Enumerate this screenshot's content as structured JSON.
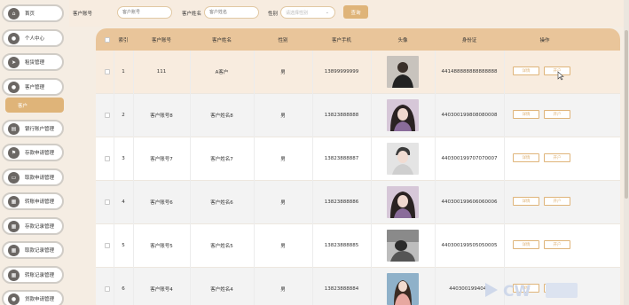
{
  "sidebar": {
    "items": [
      {
        "label": "首页",
        "icon": "home-icon"
      },
      {
        "label": "个人中心",
        "icon": "user-icon"
      },
      {
        "label": "租赁管理",
        "icon": "send-icon"
      },
      {
        "label": "客户管理",
        "icon": "person-icon"
      },
      {
        "label": "银行账户管理",
        "icon": "bank-icon"
      },
      {
        "label": "存款申请管理",
        "icon": "flag-icon"
      },
      {
        "label": "取款申请管理",
        "icon": "withdraw-icon"
      },
      {
        "label": "转账申请管理",
        "icon": "grid-icon"
      },
      {
        "label": "存款记录管理",
        "icon": "grid-icon"
      },
      {
        "label": "取款记录管理",
        "icon": "grid-icon"
      },
      {
        "label": "转账记录管理",
        "icon": "grid-icon"
      },
      {
        "label": "贷款申请管理",
        "icon": "lightbulb-icon"
      }
    ],
    "active_sub": "客户"
  },
  "search": {
    "account_label": "客户账号",
    "account_placeholder": "客户账号",
    "name_label": "客户姓名",
    "name_placeholder": "客户姓名",
    "gender_label": "性别",
    "gender_placeholder": "请选择性别",
    "search_button": "查询"
  },
  "table": {
    "headers": [
      "索引",
      "客户账号",
      "客户姓名",
      "性别",
      "客户手机",
      "头像",
      "身份证",
      "操作"
    ],
    "rows": [
      {
        "index": "1",
        "account": "111",
        "name": "A客户",
        "gender": "男",
        "phone": "13899999999",
        "id_card": "441488888888888888"
      },
      {
        "index": "2",
        "account": "客户账号8",
        "name": "客户姓名8",
        "gender": "男",
        "phone": "13823888888",
        "id_card": "440300199808080008"
      },
      {
        "index": "3",
        "account": "客户账号7",
        "name": "客户姓名7",
        "gender": "男",
        "phone": "13823888887",
        "id_card": "440300199707070007"
      },
      {
        "index": "4",
        "account": "客户账号6",
        "name": "客户姓名6",
        "gender": "男",
        "phone": "13823888886",
        "id_card": "440300199606060006"
      },
      {
        "index": "5",
        "account": "客户账号5",
        "name": "客户姓名5",
        "gender": "男",
        "phone": "13823888885",
        "id_card": "440300199505050005"
      },
      {
        "index": "6",
        "account": "客户账号4",
        "name": "客户姓名4",
        "gender": "男",
        "phone": "13823888884",
        "id_card": "4403001994040"
      }
    ],
    "action_detail": "详情",
    "action_account": "开户"
  },
  "colors": {
    "accent": "#dfb479",
    "header_bg": "#e9c59a",
    "highlight_row": "#f8ecdf"
  }
}
